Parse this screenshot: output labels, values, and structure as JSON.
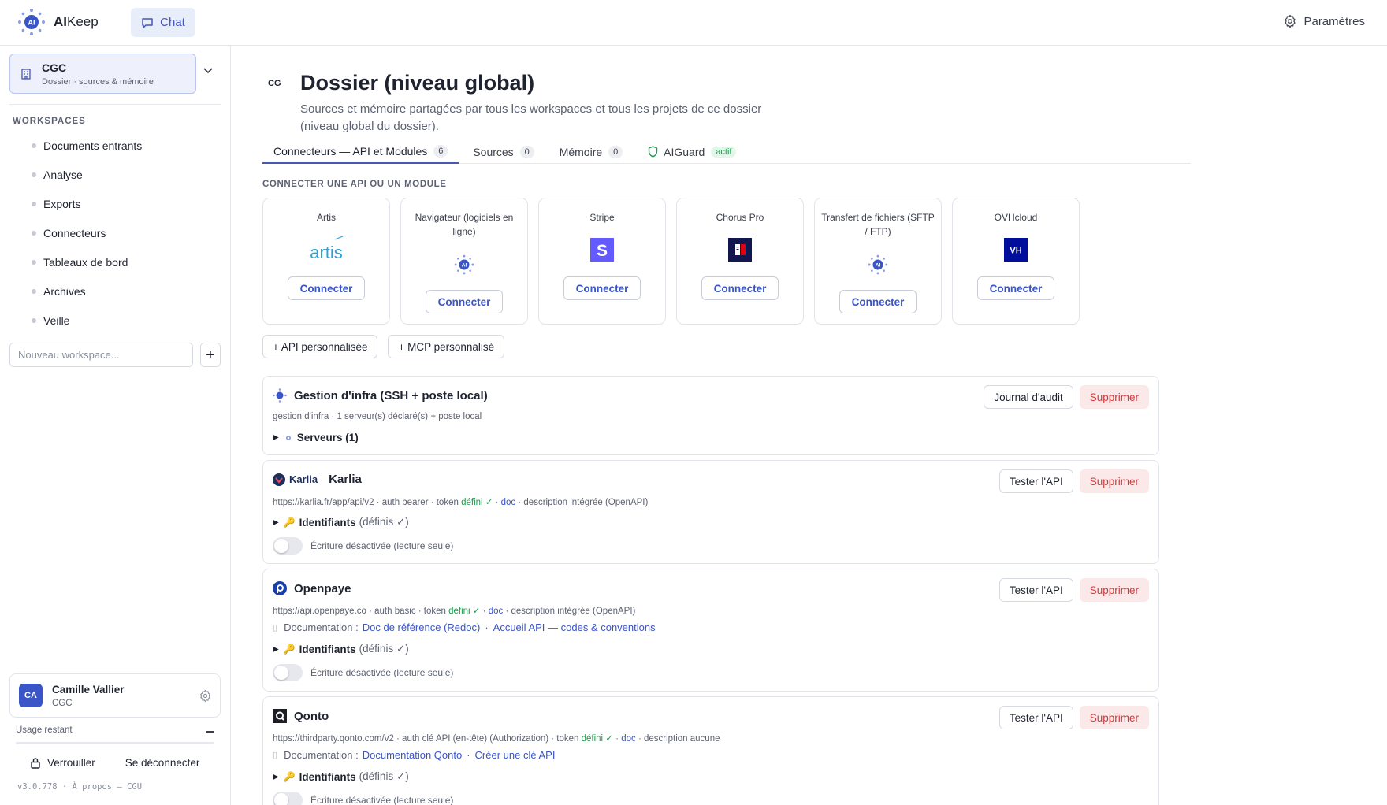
{
  "app": {
    "logo_text": "AI",
    "name_bold": "AI",
    "name_rest": "Keep"
  },
  "topbar": {
    "chat_label": "Chat",
    "settings_label": "Paramètres"
  },
  "folder": {
    "icon": "building-icon",
    "name": "CGC",
    "subtitle": "Dossier · sources & mémoire"
  },
  "sidebar": {
    "workspaces_title": "WORKSPACES",
    "workspaces": [
      "Documents entrants",
      "Analyse",
      "Exports",
      "Connecteurs",
      "Tableaux de bord",
      "Archives",
      "Veille"
    ],
    "new_ws_placeholder": "Nouveau workspace...",
    "add_label": "+"
  },
  "user": {
    "initials": "CA",
    "name": "Camille Vallier",
    "org": "CGC",
    "usage_label": "Usage restant",
    "lock_label": "Verrouiller",
    "logout_label": "Se déconnecter",
    "version": "v3.0.778 · À propos — CGU"
  },
  "page": {
    "badge": "CG",
    "title": "Dossier (niveau global)",
    "description": "Sources et mémoire partagées par tous les workspaces et tous les projets de ce dossier (niveau global du dossier).",
    "tabs": [
      {
        "label": "Connecteurs — API et Modules",
        "count": "6"
      },
      {
        "label": "Sources",
        "count": "0"
      },
      {
        "label": "Mémoire",
        "count": "0"
      },
      {
        "label": "AIGuard",
        "badge": "actif"
      }
    ],
    "connect_title": "CONNECTER UNE API OU UN MODULE",
    "modules": [
      {
        "name": "Artis",
        "logo": "artis-logo",
        "logo_text": "artis",
        "button": "Connecter"
      },
      {
        "name": "Navigateur (logiciels en ligne)",
        "logo": "aikeep-logo",
        "logo_text": "AI",
        "button": "Connecter"
      },
      {
        "name": "Stripe",
        "logo": "stripe-logo",
        "logo_text": "S",
        "button": "Connecter"
      },
      {
        "name": "Chorus Pro",
        "logo": "chorus-logo",
        "button": "Connecter"
      },
      {
        "name": "Transfert de fichiers (SFTP / FTP)",
        "logo": "aikeep-logo",
        "logo_text": "AI",
        "button": "Connecter"
      },
      {
        "name": "OVHcloud",
        "logo": "ovh-logo",
        "logo_text": "VH",
        "button": "Connecter"
      }
    ],
    "custom_api": "+  API personnalisée",
    "custom_mcp": "+  MCP personnalisé"
  },
  "connectors": [
    {
      "title": "Gestion d'infra (SSH + poste local)",
      "meta": "gestion d'infra · 1 serveur(s) déclaré(s) + poste local",
      "action": "Journal d'audit",
      "delete": "Supprimer",
      "expander": "Serveurs (1)"
    },
    {
      "title": "Karlia",
      "brand": "Karlia",
      "meta_url": "https://karlia.fr/app/api/v2 · auth bearer · token",
      "meta_ok": "défini ✓",
      "meta_doc": "doc",
      "meta_tail": "· description intégrée (OpenAPI)",
      "action": "Tester l'API",
      "delete": "Supprimer",
      "expander": "Identifiants",
      "expander_note": "(définis ✓)",
      "toggle_label": "Écriture désactivée (lecture seule)"
    },
    {
      "title": "Openpaye",
      "meta_url": "https://api.openpaye.co · auth basic · token",
      "meta_ok": "défini ✓",
      "meta_doc": "doc",
      "meta_tail": "· description intégrée (OpenAPI)",
      "doc_label": "Documentation :",
      "doc_link1": "Doc de référence (Redoc)",
      "doc_link2": "Accueil API — codes & conventions",
      "action": "Tester l'API",
      "delete": "Supprimer",
      "expander": "Identifiants",
      "expander_note": "(définis ✓)",
      "toggle_label": "Écriture désactivée (lecture seule)"
    },
    {
      "title": "Qonto",
      "meta_url": "https://thirdparty.qonto.com/v2 · auth clé API (en-tête) (Authorization) · token",
      "meta_ok": "défini ✓",
      "meta_doc": "doc",
      "meta_tail": "· description aucune",
      "doc_label": "Documentation :",
      "doc_link1": "Documentation Qonto",
      "doc_link2": "Créer une clé API",
      "action": "Tester l'API",
      "delete": "Supprimer",
      "expander": "Identifiants",
      "expander_note": "(définis ✓)",
      "toggle_label": "Écriture désactivée (lecture seule)"
    }
  ],
  "colors": {
    "accent": "#3a55c8",
    "accent_soft": "#e8edfa",
    "danger": "#d0393a",
    "danger_bg": "#fbe9e9",
    "success": "#1f9a4d"
  }
}
